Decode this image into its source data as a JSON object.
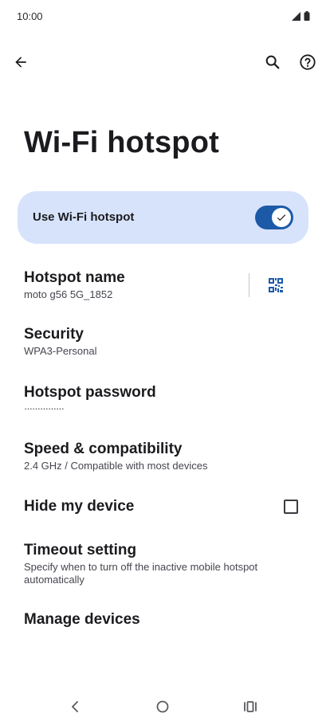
{
  "status_bar": {
    "time": "10:00"
  },
  "app_bar": {
    "back_icon": "arrow-back-icon",
    "search_icon": "search-icon",
    "help_icon": "help-circle-icon"
  },
  "page": {
    "title": "Wi-Fi hotspot"
  },
  "main_toggle": {
    "label": "Use Wi-Fi hotspot",
    "enabled": true,
    "accent_color": "#1c5aa8",
    "card_color": "#d7e3fb"
  },
  "settings": {
    "hotspot_name": {
      "title": "Hotspot name",
      "summary": "moto g56 5G_1852",
      "qr_icon": "qr-code-icon"
    },
    "security": {
      "title": "Security",
      "summary": "WPA3-Personal"
    },
    "password": {
      "title": "Hotspot password",
      "summary": "···············"
    },
    "speed": {
      "title": "Speed & compatibility",
      "summary": "2.4 GHz / Compatible with most devices"
    },
    "hide_device": {
      "title": "Hide my device",
      "checked": false
    },
    "timeout": {
      "title": "Timeout setting",
      "summary": "Specify when to turn off the inactive mobile hotspot automatically"
    },
    "manage": {
      "title": "Manage devices"
    }
  },
  "nav_bar": {
    "back_icon": "nav-back-icon",
    "home_icon": "nav-home-icon",
    "recents_icon": "nav-recents-icon"
  }
}
